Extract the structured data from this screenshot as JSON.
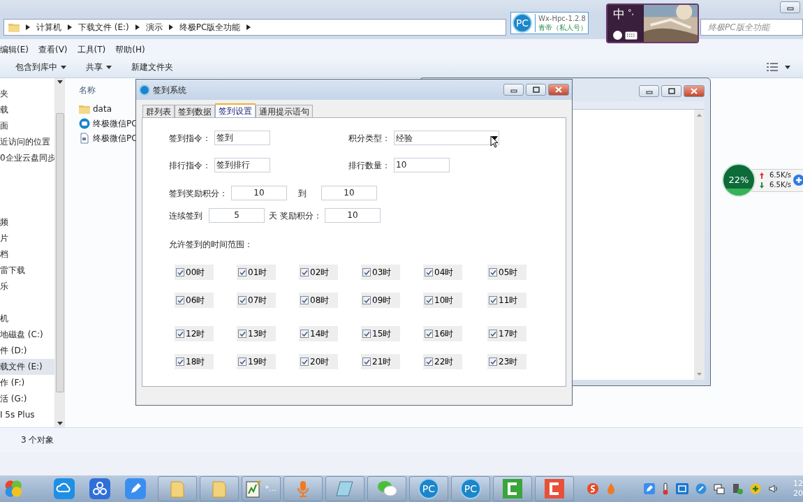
{
  "explorer": {
    "breadcrumbs": [
      "计算机",
      "下载文件 (E:)",
      "演示",
      "终极PC版全功能"
    ],
    "search": {
      "placeholder": "终极PC版全功能"
    },
    "menu": [
      "编辑(E)",
      "查看(V)",
      "工具(T)",
      "帮助(H)"
    ],
    "toolbar": [
      {
        "label": "包含到库中",
        "dropdown": true
      },
      {
        "label": "共享",
        "dropdown": true
      },
      {
        "label": "新建文件夹",
        "dropdown": false
      }
    ],
    "nav_groups": [
      [
        {
          "label": "夹",
          "selected": false
        },
        {
          "label": "载",
          "selected": false
        },
        {
          "label": "面",
          "selected": false
        },
        {
          "label": "近访问的位置",
          "selected": false
        },
        {
          "label": "0企业云盘同步",
          "selected": false
        }
      ],
      [
        {
          "label": "频",
          "selected": false
        },
        {
          "label": "片",
          "selected": false
        },
        {
          "label": "档",
          "selected": false
        },
        {
          "label": "雷下载",
          "selected": false
        },
        {
          "label": "乐",
          "selected": false
        }
      ],
      [
        {
          "label": "机",
          "selected": false
        },
        {
          "label": "地磁盘 (C:)",
          "selected": false
        },
        {
          "label": "件 (D:)",
          "selected": false
        },
        {
          "label": "载文件 (E:)",
          "selected": true
        },
        {
          "label": "作 (F:)",
          "selected": false
        },
        {
          "label": "活 (G:)",
          "selected": false
        },
        {
          "label": "I 5s Plus",
          "selected": false
        }
      ]
    ],
    "column": "名称",
    "files": [
      {
        "name": "data",
        "kind": "folder"
      },
      {
        "name": "终极微信PC",
        "kind": "app"
      },
      {
        "name": "终极微信PC",
        "kind": "document"
      }
    ],
    "status": "3 个对象"
  },
  "badge": {
    "logo": "PC",
    "name": "Wx-Hpc-1.2.8",
    "account": "青帝（私人号）"
  },
  "ime": {
    "mode": "中",
    "punct": "°,"
  },
  "net_meter": {
    "cpu": "22%",
    "up": "6.5K/s",
    "down": "6.5K/s"
  },
  "dialog": {
    "title": "签到系统",
    "tabs": [
      {
        "label": "群列表",
        "selected": false
      },
      {
        "label": "签到数据",
        "selected": false
      },
      {
        "label": "签到设置",
        "selected": true
      },
      {
        "label": "通用提示语句",
        "selected": false
      }
    ],
    "sign_command": {
      "label": "签到指令：",
      "value": "签到"
    },
    "points_type": {
      "label": "积分类型：",
      "value": "经验"
    },
    "rank_command": {
      "label": "排行指令：",
      "value": "签到排行"
    },
    "rank_count": {
      "label": "排行数量：",
      "value": "10"
    },
    "reward": {
      "label": "签到奖励积分：",
      "min": "10",
      "to": "到",
      "max": "10"
    },
    "streak": {
      "label": "连续签到",
      "days": "5",
      "unit": "天",
      "bonus_label": "奖励积分：",
      "bonus": "10"
    },
    "hours_title": "允许签到的时间范围：",
    "hours": [
      {
        "label": "00时",
        "checked": true
      },
      {
        "label": "01时",
        "checked": true
      },
      {
        "label": "02时",
        "checked": true
      },
      {
        "label": "03时",
        "checked": true
      },
      {
        "label": "04时",
        "checked": true
      },
      {
        "label": "05时",
        "checked": true
      },
      {
        "label": "06时",
        "checked": true
      },
      {
        "label": "07时",
        "checked": true
      },
      {
        "label": "08时",
        "checked": true
      },
      {
        "label": "09时",
        "checked": true
      },
      {
        "label": "10时",
        "checked": true
      },
      {
        "label": "11时",
        "checked": true
      },
      {
        "label": "12时",
        "checked": true
      },
      {
        "label": "13时",
        "checked": true
      },
      {
        "label": "14时",
        "checked": true
      },
      {
        "label": "15时",
        "checked": true
      },
      {
        "label": "16时",
        "checked": true
      },
      {
        "label": "17时",
        "checked": true
      },
      {
        "label": "18时",
        "checked": true
      },
      {
        "label": "19时",
        "checked": true
      },
      {
        "label": "20时",
        "checked": true
      },
      {
        "label": "21时",
        "checked": true
      },
      {
        "label": "22时",
        "checked": true
      },
      {
        "label": "23时",
        "checked": true
      }
    ]
  },
  "taskbar": {
    "notepad_caption": "*...",
    "apps": [
      {
        "logo": "PC"
      },
      {
        "logo": "PC"
      }
    ],
    "clock": [
      "12",
      "20"
    ]
  }
}
